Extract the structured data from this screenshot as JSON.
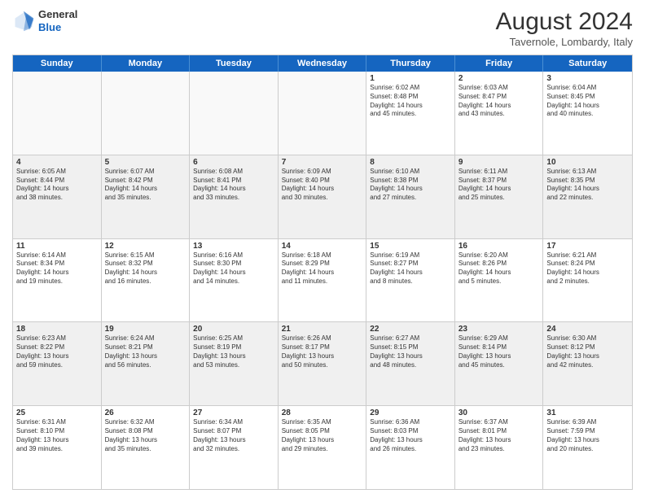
{
  "header": {
    "logo_general": "General",
    "logo_blue": "Blue",
    "month_year": "August 2024",
    "location": "Tavernole, Lombardy, Italy"
  },
  "days_of_week": [
    "Sunday",
    "Monday",
    "Tuesday",
    "Wednesday",
    "Thursday",
    "Friday",
    "Saturday"
  ],
  "rows": [
    {
      "cells": [
        {
          "day": "",
          "empty": true
        },
        {
          "day": "",
          "empty": true
        },
        {
          "day": "",
          "empty": true
        },
        {
          "day": "",
          "empty": true
        },
        {
          "day": "1",
          "lines": [
            "Sunrise: 6:02 AM",
            "Sunset: 8:48 PM",
            "Daylight: 14 hours",
            "and 45 minutes."
          ]
        },
        {
          "day": "2",
          "lines": [
            "Sunrise: 6:03 AM",
            "Sunset: 8:47 PM",
            "Daylight: 14 hours",
            "and 43 minutes."
          ]
        },
        {
          "day": "3",
          "lines": [
            "Sunrise: 6:04 AM",
            "Sunset: 8:45 PM",
            "Daylight: 14 hours",
            "and 40 minutes."
          ]
        }
      ]
    },
    {
      "cells": [
        {
          "day": "4",
          "lines": [
            "Sunrise: 6:05 AM",
            "Sunset: 8:44 PM",
            "Daylight: 14 hours",
            "and 38 minutes."
          ]
        },
        {
          "day": "5",
          "lines": [
            "Sunrise: 6:07 AM",
            "Sunset: 8:42 PM",
            "Daylight: 14 hours",
            "and 35 minutes."
          ]
        },
        {
          "day": "6",
          "lines": [
            "Sunrise: 6:08 AM",
            "Sunset: 8:41 PM",
            "Daylight: 14 hours",
            "and 33 minutes."
          ]
        },
        {
          "day": "7",
          "lines": [
            "Sunrise: 6:09 AM",
            "Sunset: 8:40 PM",
            "Daylight: 14 hours",
            "and 30 minutes."
          ]
        },
        {
          "day": "8",
          "lines": [
            "Sunrise: 6:10 AM",
            "Sunset: 8:38 PM",
            "Daylight: 14 hours",
            "and 27 minutes."
          ]
        },
        {
          "day": "9",
          "lines": [
            "Sunrise: 6:11 AM",
            "Sunset: 8:37 PM",
            "Daylight: 14 hours",
            "and 25 minutes."
          ]
        },
        {
          "day": "10",
          "lines": [
            "Sunrise: 6:13 AM",
            "Sunset: 8:35 PM",
            "Daylight: 14 hours",
            "and 22 minutes."
          ]
        }
      ]
    },
    {
      "cells": [
        {
          "day": "11",
          "lines": [
            "Sunrise: 6:14 AM",
            "Sunset: 8:34 PM",
            "Daylight: 14 hours",
            "and 19 minutes."
          ]
        },
        {
          "day": "12",
          "lines": [
            "Sunrise: 6:15 AM",
            "Sunset: 8:32 PM",
            "Daylight: 14 hours",
            "and 16 minutes."
          ]
        },
        {
          "day": "13",
          "lines": [
            "Sunrise: 6:16 AM",
            "Sunset: 8:30 PM",
            "Daylight: 14 hours",
            "and 14 minutes."
          ]
        },
        {
          "day": "14",
          "lines": [
            "Sunrise: 6:18 AM",
            "Sunset: 8:29 PM",
            "Daylight: 14 hours",
            "and 11 minutes."
          ]
        },
        {
          "day": "15",
          "lines": [
            "Sunrise: 6:19 AM",
            "Sunset: 8:27 PM",
            "Daylight: 14 hours",
            "and 8 minutes."
          ]
        },
        {
          "day": "16",
          "lines": [
            "Sunrise: 6:20 AM",
            "Sunset: 8:26 PM",
            "Daylight: 14 hours",
            "and 5 minutes."
          ]
        },
        {
          "day": "17",
          "lines": [
            "Sunrise: 6:21 AM",
            "Sunset: 8:24 PM",
            "Daylight: 14 hours",
            "and 2 minutes."
          ]
        }
      ]
    },
    {
      "cells": [
        {
          "day": "18",
          "lines": [
            "Sunrise: 6:23 AM",
            "Sunset: 8:22 PM",
            "Daylight: 13 hours",
            "and 59 minutes."
          ]
        },
        {
          "day": "19",
          "lines": [
            "Sunrise: 6:24 AM",
            "Sunset: 8:21 PM",
            "Daylight: 13 hours",
            "and 56 minutes."
          ]
        },
        {
          "day": "20",
          "lines": [
            "Sunrise: 6:25 AM",
            "Sunset: 8:19 PM",
            "Daylight: 13 hours",
            "and 53 minutes."
          ]
        },
        {
          "day": "21",
          "lines": [
            "Sunrise: 6:26 AM",
            "Sunset: 8:17 PM",
            "Daylight: 13 hours",
            "and 50 minutes."
          ]
        },
        {
          "day": "22",
          "lines": [
            "Sunrise: 6:27 AM",
            "Sunset: 8:15 PM",
            "Daylight: 13 hours",
            "and 48 minutes."
          ]
        },
        {
          "day": "23",
          "lines": [
            "Sunrise: 6:29 AM",
            "Sunset: 8:14 PM",
            "Daylight: 13 hours",
            "and 45 minutes."
          ]
        },
        {
          "day": "24",
          "lines": [
            "Sunrise: 6:30 AM",
            "Sunset: 8:12 PM",
            "Daylight: 13 hours",
            "and 42 minutes."
          ]
        }
      ]
    },
    {
      "cells": [
        {
          "day": "25",
          "lines": [
            "Sunrise: 6:31 AM",
            "Sunset: 8:10 PM",
            "Daylight: 13 hours",
            "and 39 minutes."
          ]
        },
        {
          "day": "26",
          "lines": [
            "Sunrise: 6:32 AM",
            "Sunset: 8:08 PM",
            "Daylight: 13 hours",
            "and 35 minutes."
          ]
        },
        {
          "day": "27",
          "lines": [
            "Sunrise: 6:34 AM",
            "Sunset: 8:07 PM",
            "Daylight: 13 hours",
            "and 32 minutes."
          ]
        },
        {
          "day": "28",
          "lines": [
            "Sunrise: 6:35 AM",
            "Sunset: 8:05 PM",
            "Daylight: 13 hours",
            "and 29 minutes."
          ]
        },
        {
          "day": "29",
          "lines": [
            "Sunrise: 6:36 AM",
            "Sunset: 8:03 PM",
            "Daylight: 13 hours",
            "and 26 minutes."
          ]
        },
        {
          "day": "30",
          "lines": [
            "Sunrise: 6:37 AM",
            "Sunset: 8:01 PM",
            "Daylight: 13 hours",
            "and 23 minutes."
          ]
        },
        {
          "day": "31",
          "lines": [
            "Sunrise: 6:39 AM",
            "Sunset: 7:59 PM",
            "Daylight: 13 hours",
            "and 20 minutes."
          ]
        }
      ]
    }
  ]
}
